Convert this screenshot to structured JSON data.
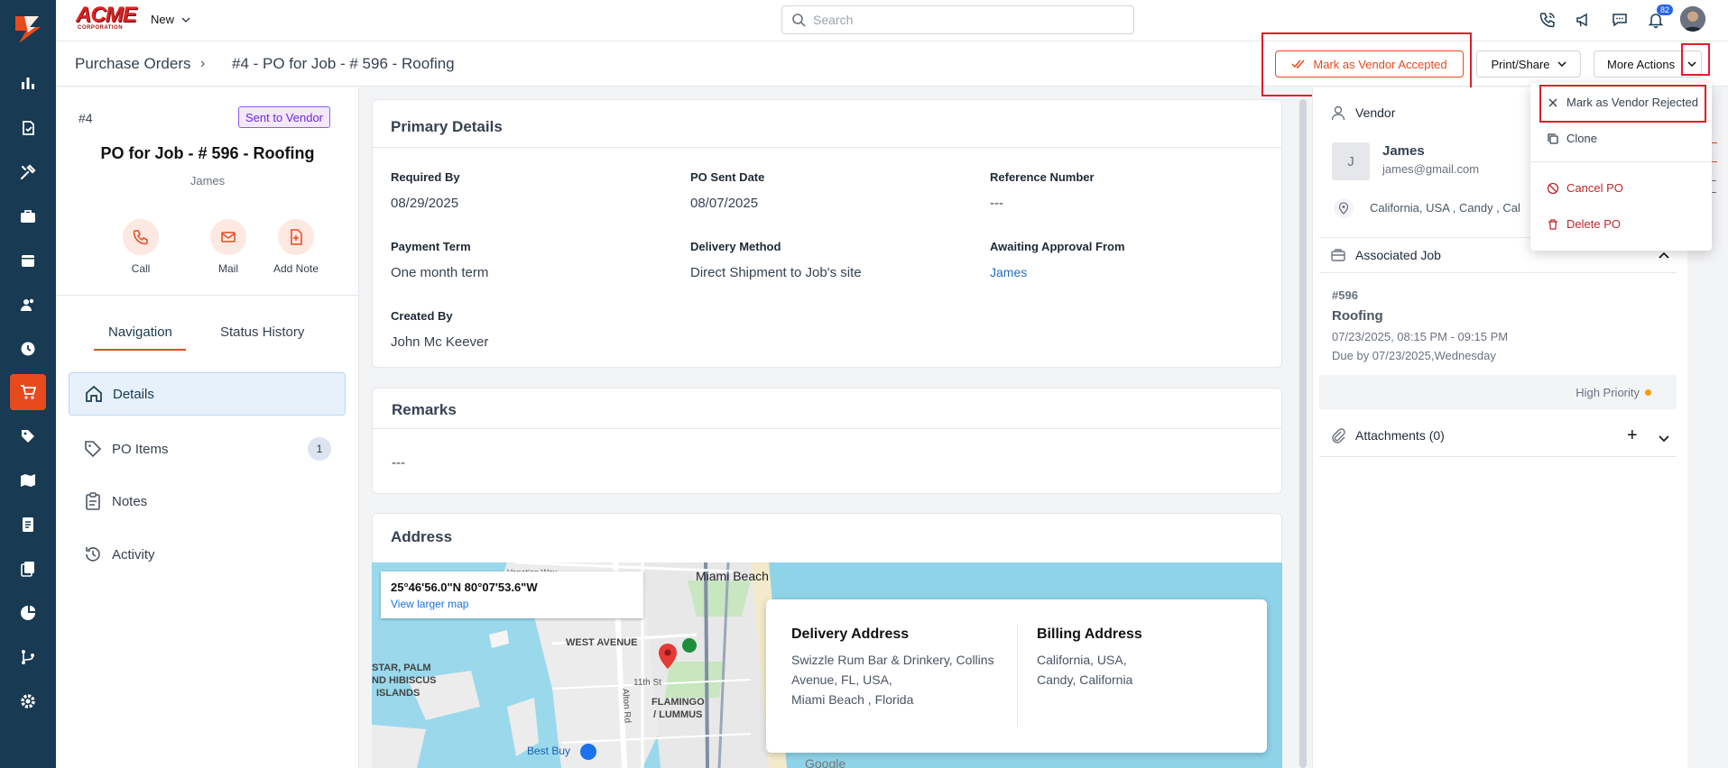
{
  "header": {
    "brand_name": "ACME",
    "brand_sub": "CORPORATION",
    "new_label": "New",
    "search_placeholder": "Search",
    "notification_count": "82"
  },
  "breadcrumb": {
    "parent": "Purchase Orders",
    "current": "#4 - PO for Job - # 596 - Roofing"
  },
  "actions": {
    "accept_label": "Mark as Vendor Accepted",
    "print_label": "Print/Share",
    "more_label": "More Actions"
  },
  "dropdown": {
    "items": [
      {
        "label": "Mark as Vendor Rejected",
        "icon": "close-icon"
      },
      {
        "label": "Clone",
        "icon": "copy-icon"
      },
      {
        "label": "Cancel PO",
        "icon": "ban-icon"
      },
      {
        "label": "Delete PO",
        "icon": "trash-icon"
      }
    ]
  },
  "po": {
    "number": "#4",
    "status": "Sent to Vendor",
    "title": "PO for Job - # 596 - Roofing",
    "vendor_short": "James"
  },
  "quick_actions": [
    "Call",
    "Mail",
    "Add Note"
  ],
  "tabs": [
    "Navigation",
    "Status History"
  ],
  "nav": {
    "items": [
      {
        "label": "Details",
        "icon": "home-icon"
      },
      {
        "label": "PO Items",
        "icon": "tag-icon",
        "count": "1"
      },
      {
        "label": "Notes",
        "icon": "clipboard-icon"
      },
      {
        "label": "Activity",
        "icon": "history-icon"
      }
    ]
  },
  "primary": {
    "title": "Primary Details",
    "fields": [
      {
        "label": "Required By",
        "value": "08/29/2025"
      },
      {
        "label": "PO Sent Date",
        "value": "08/07/2025"
      },
      {
        "label": "Reference Number",
        "value": "---"
      },
      {
        "label": "Payment Term",
        "value": "One month term"
      },
      {
        "label": "Delivery Method",
        "value": "Direct Shipment to Job's site"
      },
      {
        "label": "Awaiting Approval From",
        "value": "James"
      },
      {
        "label": "Created By",
        "value": "John Mc Keever"
      }
    ]
  },
  "remarks": {
    "title": "Remarks",
    "value": "---"
  },
  "address": {
    "title": "Address",
    "map_coords": "25°46'56.0\"N 80°07'53.6\"W",
    "map_link": "View larger map",
    "map_labels": [
      "Miami Beach",
      "WEST AVENUE",
      "STAR, PALM",
      "ND HIBISCUS",
      "ISLANDS",
      "FLAMINGO",
      "/ LUMMUS",
      "Best Buy",
      "Alton Rd",
      "11th St",
      "Venetian Way",
      "Google"
    ],
    "delivery_title": "Delivery Address",
    "delivery_lines": [
      "Swizzle Rum Bar & Drinkery, Collins",
      "Avenue, FL, USA,",
      "Miami Beach , Florida"
    ],
    "billing_title": "Billing Address",
    "billing_lines": [
      "California, USA,",
      "Candy, California"
    ]
  },
  "vendor": {
    "section": "Vendor",
    "initial": "J",
    "name": "James",
    "email": "james@gmail.com",
    "location": "California, USA , Candy , Cal"
  },
  "job": {
    "section": "Associated Job",
    "number": "#596",
    "name": "Roofing",
    "time": "07/23/2025, 08:15 PM - 09:15 PM",
    "due": "Due by 07/23/2025,Wednesday",
    "priority": "High Priority"
  },
  "attachments": {
    "label": "Attachments (0)"
  },
  "colors": {
    "brand_orange": "#e8491d",
    "rail_navy": "#183a52",
    "highlight_red": "#e11d2b"
  }
}
